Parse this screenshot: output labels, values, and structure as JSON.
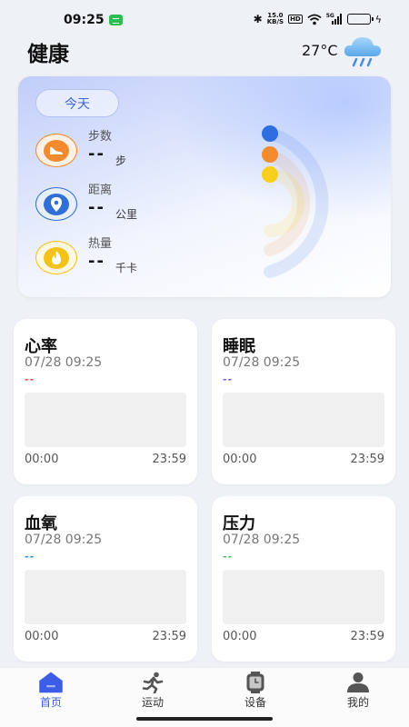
{
  "status_bar": {
    "time": "09:25",
    "net_speed_value": "15.0",
    "net_speed_unit": "KB/S",
    "hd_label": "HD",
    "signal_label": "5G"
  },
  "header": {
    "title": "健康",
    "weather_temp": "27°C",
    "weather_icon": "rain-cloud-icon"
  },
  "summary": {
    "today_button": "今天",
    "metrics": [
      {
        "label": "步数",
        "value": "--",
        "unit": "步",
        "icon": "shoe-icon",
        "color": "#f28a2e"
      },
      {
        "label": "距离",
        "value": "--",
        "unit": "公里",
        "icon": "location-pin-icon",
        "color": "#2f6fd6"
      },
      {
        "label": "热量",
        "value": "--",
        "unit": "千卡",
        "icon": "flame-icon",
        "color": "#f3c21b"
      }
    ],
    "ring_colors": [
      "#2f6ee0",
      "#f28a2e",
      "#f7cf1f"
    ]
  },
  "cards": [
    {
      "title": "心率",
      "time": "07/28 09:25",
      "value": "--",
      "value_color": "#e0514d",
      "start": "00:00",
      "end": "23:59"
    },
    {
      "title": "睡眠",
      "time": "07/28 09:25",
      "value": "--",
      "value_color": "#6b5bd6",
      "start": "00:00",
      "end": "23:59"
    },
    {
      "title": "血氧",
      "time": "07/28 09:25",
      "value": "--",
      "value_color": "#2f8fd8",
      "start": "00:00",
      "end": "23:59"
    },
    {
      "title": "压力",
      "time": "07/28 09:25",
      "value": "--",
      "value_color": "#3fbf6a",
      "start": "00:00",
      "end": "23:59"
    }
  ],
  "tabs": [
    {
      "label": "首页",
      "icon": "home-icon",
      "active": true
    },
    {
      "label": "运动",
      "icon": "running-icon",
      "active": false
    },
    {
      "label": "设备",
      "icon": "watch-icon",
      "active": false
    },
    {
      "label": "我的",
      "icon": "profile-icon",
      "active": false
    }
  ],
  "colors": {
    "accent": "#3d5de6"
  }
}
